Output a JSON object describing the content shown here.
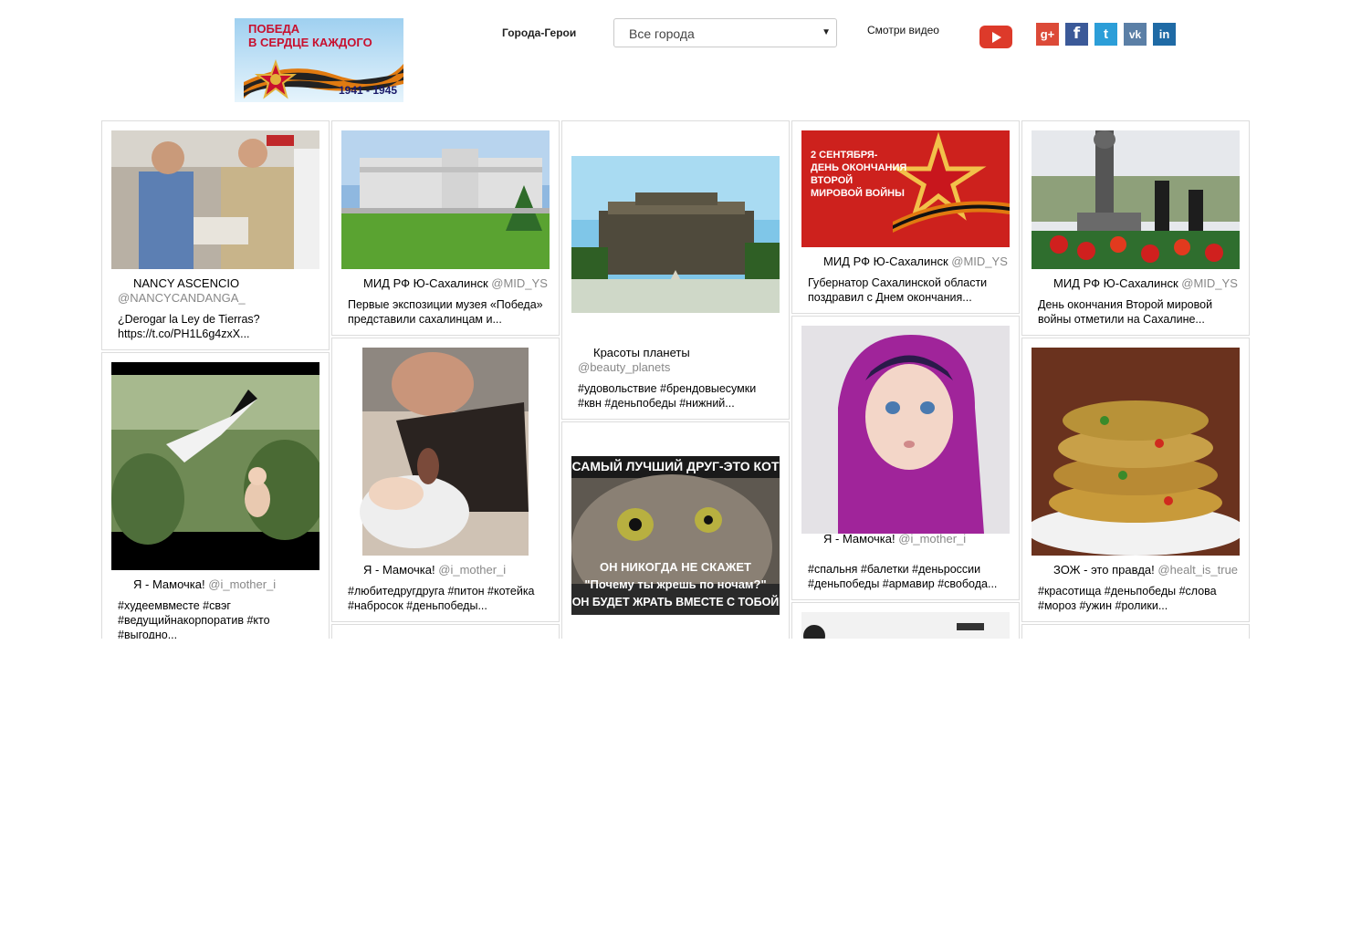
{
  "header": {
    "logo_lines": [
      "ПОБЕДА",
      "В СЕРДЦЕ КАЖДОГО"
    ],
    "logo_years": "1941 - 1945",
    "cities_label": "Города-Герои",
    "city_select_value": "Все города",
    "video_link": "Смотри видео",
    "social": [
      {
        "icon": "google-plus-icon",
        "glyph": "g+",
        "color": "#dc4a38"
      },
      {
        "icon": "facebook-icon",
        "glyph": "f",
        "color": "#3b5998"
      },
      {
        "icon": "twitter-icon",
        "glyph": "t",
        "color": "#2c9ed8"
      },
      {
        "icon": "vk-icon",
        "glyph": "vk",
        "color": "#5b7fa6"
      },
      {
        "icon": "linkedin-icon",
        "glyph": "in",
        "color": "#1f6aa5"
      }
    ]
  },
  "posts": {
    "c1p1": {
      "name": "NANCY ASCENCIO",
      "handle": "@NANCYCANDANGA_",
      "text": "¿Derogar la Ley de Tierras? https://t.co/PH1L6g4zxX..."
    },
    "c1p2": {
      "name": "Я - Мамочка!",
      "handle": "@i_mother_i",
      "text": "#худеемвместе #свэг #ведущийнакорпоратив #кто #выгодно..."
    },
    "c2p1": {
      "name": "МИД РФ Ю-Сахалинск",
      "handle": "@MID_YS",
      "text": "Первые экспозиции музея «Победа» представили сахалинцам и..."
    },
    "c2p2": {
      "name": "Я - Мамочка!",
      "handle": "@i_mother_i",
      "text": "#любитедругдруга #питон #котейка #набросок #деньпобеды..."
    },
    "c3p1": {
      "name": "Красоты планеты",
      "handle": "@beauty_planets",
      "text": "#удовольствие #брендовыесумки #квн #деньпобеды #нижний..."
    },
    "c3p2": {
      "caption_top": "САМЫЙ ЛУЧШИЙ ДРУГ-ЭТО КОТ",
      "caption_mid": "ОН НИКОГДА НЕ СКАЖЕТ",
      "caption_q": "\"Почему ты жрешь по ночам?\"",
      "caption_bottom": "ОН БУДЕТ ЖРАТЬ ВМЕСТЕ С ТОБОЙ"
    },
    "c4p1": {
      "banner_l1": "2 СЕНТЯБРЯ-",
      "banner_l2": "ДЕНЬ ОКОНЧАНИЯ",
      "banner_l3": "ВТОРОЙ",
      "banner_l4": "МИРОВОЙ ВОЙНЫ",
      "name": "МИД РФ Ю-Сахалинск",
      "handle": "@MID_YS",
      "text": "Губернатор Сахалинской области поздравил с Днем окончания..."
    },
    "c4p2": {
      "name": "Я - Мамочка!",
      "handle": "@i_mother_i",
      "text": "#спальня #балетки #деньроссии #деньпобеды #армавир #свобода..."
    },
    "c5p1": {
      "name": "МИД РФ Ю-Сахалинск",
      "handle": "@MID_YS",
      "text": "День окончания Второй мировой войны отметили на Сахалине..."
    },
    "c5p2": {
      "name": "ЗОЖ - это правда!",
      "handle": "@healt_is_true",
      "text": "#красотища #деньпобеды #слова #мороз #ужин #ролики..."
    }
  }
}
